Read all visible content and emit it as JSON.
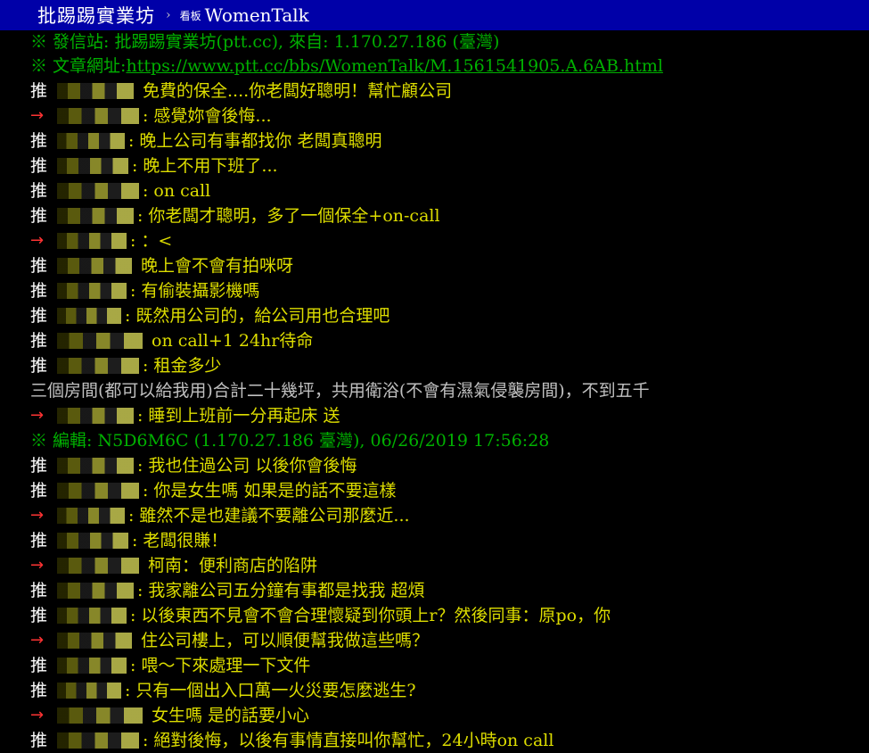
{
  "header": {
    "site_name": "批踢踢實業坊",
    "separator": "›",
    "board_label": "看板",
    "board_name": "WomenTalk"
  },
  "meta": {
    "source_line": "※ 發信站: 批踢踢實業坊(ptt.cc), 來自: 1.170.27.186 (臺灣)",
    "url_label": "※ 文章網址: ",
    "url": "https://www.ptt.cc/bbs/WomenTalk/M.1561541905.A.6AB.html",
    "edit_line": "※ 編輯: N5D6M6C (1.170.27.186 臺灣), 06/26/2019 17:56:28"
  },
  "author_reply": "三個房間(都可以給我用)合計二十幾坪，共用衛浴(不會有濕氣侵襲房間)，不到五千",
  "comments_a": [
    {
      "tag": "推",
      "kind": "push",
      "msg": "免費的保全....你老闆好聰明！幫忙顧公司",
      "colon": ""
    },
    {
      "tag": "→",
      "kind": "arrow",
      "msg": "感覺妳會後悔...",
      "colon": ":"
    },
    {
      "tag": "推",
      "kind": "push",
      "msg": "晚上公司有事都找你 老闆真聰明",
      "colon": ":"
    },
    {
      "tag": "推",
      "kind": "push",
      "msg": "晚上不用下班了...",
      "colon": ":"
    },
    {
      "tag": "推",
      "kind": "push",
      "msg": "on call",
      "colon": ":"
    },
    {
      "tag": "推",
      "kind": "push",
      "msg": "你老闆才聰明，多了一個保全+on-call",
      "colon": ":"
    },
    {
      "tag": "→",
      "kind": "arrow",
      "msg": "：<",
      "colon": ":"
    },
    {
      "tag": "推",
      "kind": "push",
      "msg": "晚上會不會有拍咪呀",
      "colon": ""
    },
    {
      "tag": "推",
      "kind": "push",
      "msg": "有偷裝攝影機嗎",
      "colon": ":"
    },
    {
      "tag": "推",
      "kind": "push",
      "msg": "既然用公司的，給公司用也合理吧",
      "colon": ":"
    },
    {
      "tag": "推",
      "kind": "push",
      "msg": "on call+1 24hr待命",
      "colon": ""
    },
    {
      "tag": "推",
      "kind": "push",
      "msg": "租金多少",
      "colon": ":"
    }
  ],
  "comments_b": [
    {
      "tag": "→",
      "kind": "arrow",
      "msg": "睡到上班前一分再起床 送",
      "colon": ":"
    }
  ],
  "comments_c": [
    {
      "tag": "推",
      "kind": "push",
      "msg": "我也住過公司 以後你會後悔",
      "colon": ":"
    },
    {
      "tag": "推",
      "kind": "push",
      "msg": "你是女生嗎 如果是的話不要這樣",
      "colon": ":"
    },
    {
      "tag": "→",
      "kind": "arrow",
      "msg": "雖然不是也建議不要離公司那麼近...",
      "colon": ":"
    },
    {
      "tag": "推",
      "kind": "push",
      "msg": "老闆很賺！",
      "colon": ":"
    },
    {
      "tag": "→",
      "kind": "arrow",
      "msg": "柯南：便利商店的陷阱",
      "colon": ""
    },
    {
      "tag": "推",
      "kind": "push",
      "msg": "我家離公司五分鐘有事都是找我 超煩",
      "colon": ":"
    },
    {
      "tag": "推",
      "kind": "push",
      "msg": "以後東西不見會不會合理懷疑到你頭上r？然後同事：原po，你",
      "colon": ":"
    },
    {
      "tag": "→",
      "kind": "arrow",
      "msg": "住公司樓上，可以順便幫我做這些嗎？",
      "colon": ""
    },
    {
      "tag": "推",
      "kind": "push",
      "msg": "喂～下來處理一下文件",
      "colon": ":"
    },
    {
      "tag": "推",
      "kind": "push",
      "msg": "只有一個出入口萬一火災要怎麼逃生?",
      "colon": ":"
    },
    {
      "tag": "→",
      "kind": "arrow",
      "msg": "女生嗎 是的話要小心",
      "colon": ""
    },
    {
      "tag": "推",
      "kind": "push",
      "msg": "絕對後悔，以後有事情直接叫你幫忙，24小時on call",
      "colon": ":"
    }
  ],
  "colors": {
    "title_bar": "#0000a8",
    "push_tag": "#ffffff",
    "arrow_tag": "#ff3333",
    "comment_text": "#dddd00",
    "system_text": "#00b000",
    "body_text": "#c0c0c0"
  }
}
